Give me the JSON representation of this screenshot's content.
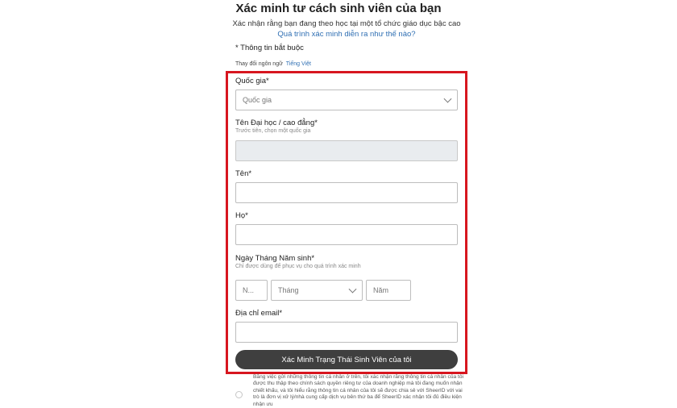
{
  "header": {
    "title": "Xác minh tư cách sinh viên của bạn",
    "subtitle": "Xác nhận rằng bạn đang theo học tại một tổ chức giáo dục bậc cao",
    "process_link": "Quá trình xác minh diễn ra như thế nào?"
  },
  "required_note": "* Thông tin bắt buộc",
  "language": {
    "label": "Thay đổi ngôn ngữ",
    "current": "Tiếng Việt"
  },
  "form": {
    "country": {
      "label": "Quốc gia*",
      "placeholder": "Quốc gia"
    },
    "school": {
      "label": "Tên Đại học / cao đẳng*",
      "hint": "Trước tiên, chọn một quốc gia",
      "value": ""
    },
    "first_name": {
      "label": "Tên*",
      "value": ""
    },
    "last_name": {
      "label": "Họ*",
      "value": ""
    },
    "birth_date": {
      "label": "Ngày Tháng Năm sinh*",
      "hint": "Chỉ được dùng để phục vụ cho quá trình xác minh",
      "day_placeholder": "N...",
      "month_placeholder": "Tháng",
      "year_placeholder": "Năm"
    },
    "email": {
      "label": "Địa chỉ email*",
      "value": ""
    },
    "submit_label": "Xác Minh Trạng Thái Sinh Viên của tôi"
  },
  "consent_text": "Bằng việc gửi những thông tin cá nhân ở trên, tôi xác nhận rằng thông tin cá nhân của tôi được thu thập theo chính sách quyền riêng tư của doanh nghiệp mà tôi đang muốn nhận chiết khấu, và tôi hiểu rằng thông tin cá nhân của tôi sẽ được chia sẻ với SheerID với vai trò là đơn vị xử lý/nhà cung cấp dịch vụ bên thứ ba để SheerID xác nhận tôi đủ điều kiện nhận ưu",
  "colors": {
    "highlight": "#d7161f",
    "link": "#2f6fb3",
    "button": "#3f3f3f"
  }
}
